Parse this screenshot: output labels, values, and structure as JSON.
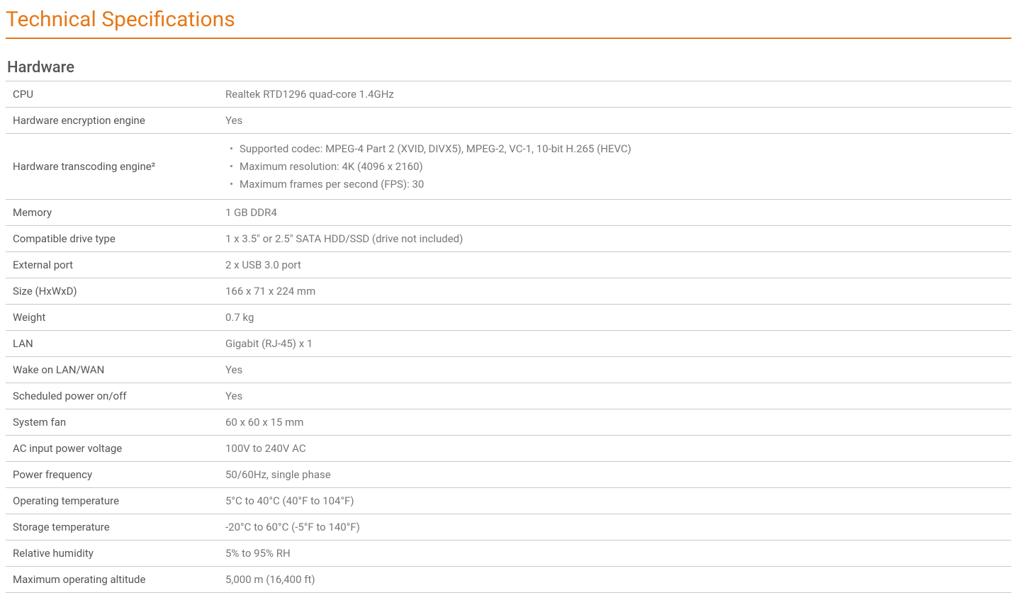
{
  "title": "Technical Specifications",
  "section": {
    "heading": "Hardware",
    "rows": [
      {
        "label": "CPU",
        "value": "Realtek RTD1296 quad-core 1.4GHz"
      },
      {
        "label": "Hardware encryption engine",
        "value": "Yes"
      },
      {
        "label": "Hardware transcoding engine²",
        "list": [
          "Supported codec: MPEG-4 Part 2 (XVID, DIVX5), MPEG-2, VC-1, 10-bit H.265 (HEVC)",
          "Maximum resolution: 4K (4096 x 2160)",
          "Maximum frames per second (FPS): 30"
        ]
      },
      {
        "label": "Memory",
        "value": "1 GB DDR4"
      },
      {
        "label": "Compatible drive type",
        "value": "1 x 3.5\" or 2.5\" SATA HDD/SSD (drive not included)"
      },
      {
        "label": "External port",
        "value": "2 x USB 3.0 port"
      },
      {
        "label": "Size (HxWxD)",
        "value": "166 x 71 x 224 mm"
      },
      {
        "label": "Weight",
        "value": "0.7 kg"
      },
      {
        "label": "LAN",
        "value": "Gigabit (RJ-45) x 1"
      },
      {
        "label": "Wake on LAN/WAN",
        "value": "Yes"
      },
      {
        "label": "Scheduled power on/off",
        "value": "Yes"
      },
      {
        "label": "System fan",
        "value": "60 x 60 x 15 mm"
      },
      {
        "label": "AC input power voltage",
        "value": "100V to 240V AC"
      },
      {
        "label": "Power frequency",
        "value": "50/60Hz, single phase"
      },
      {
        "label": "Operating temperature",
        "value": "5°C to 40°C (40°F to 104°F)"
      },
      {
        "label": "Storage temperature",
        "value": "-20°C to 60°C (-5°F to 140°F)"
      },
      {
        "label": "Relative humidity",
        "value": "5% to 95% RH"
      },
      {
        "label": "Maximum operating altitude",
        "value": "5,000 m (16,400 ft)"
      }
    ]
  }
}
